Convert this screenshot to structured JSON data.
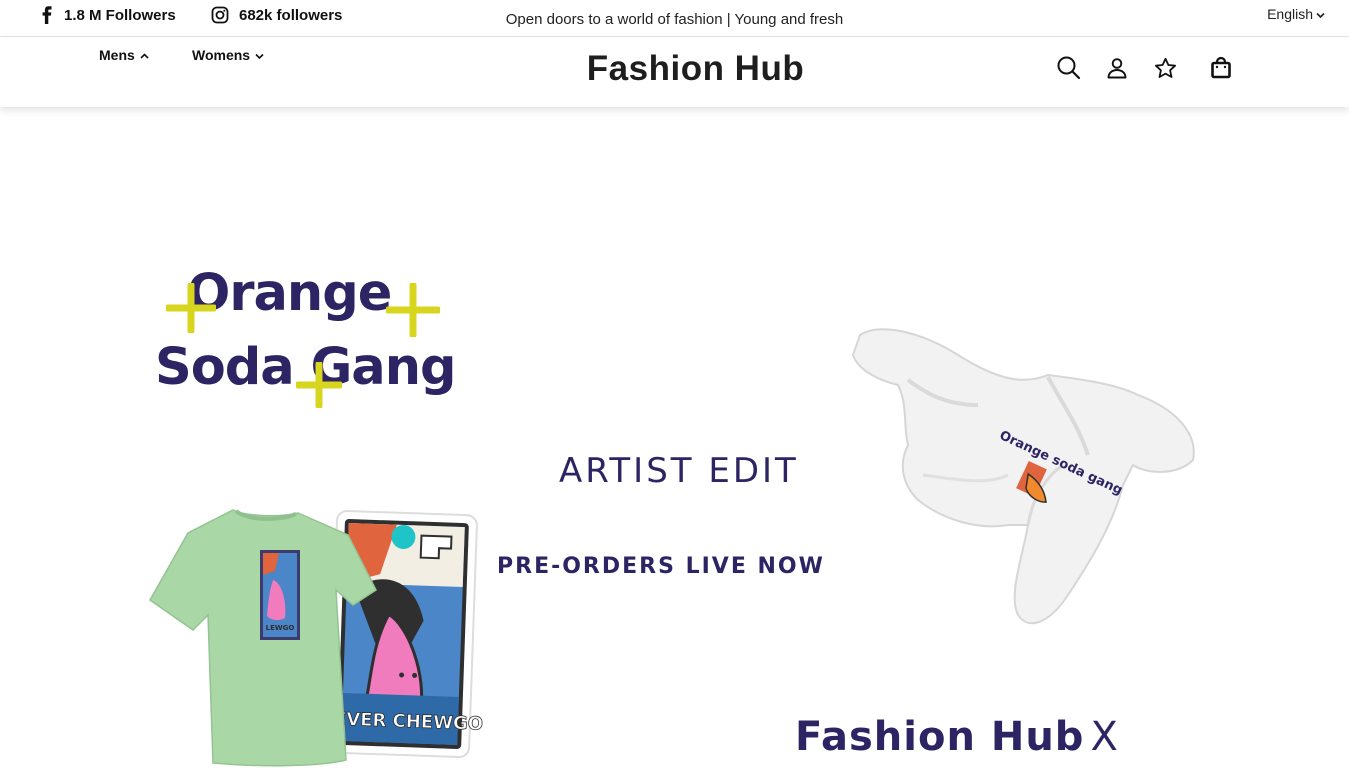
{
  "topbar": {
    "facebook": {
      "icon": "facebook-icon",
      "label": "1.8 M Followers"
    },
    "instagram": {
      "icon": "instagram-icon",
      "label": "682k followers"
    },
    "announcement": "Open doors to a world of fashion | Young and fresh",
    "language": "English"
  },
  "header": {
    "nav": [
      {
        "label": "Mens",
        "icon": "chevron-up-icon"
      },
      {
        "label": "Womens",
        "icon": "chevron-down-icon"
      }
    ],
    "brand": "Fashion Hub",
    "icons": [
      "search-icon",
      "user-icon",
      "star-icon",
      "shopping-bag-icon"
    ]
  },
  "hero": {
    "artwork_line1": "Orange",
    "artwork_line2": "Soda Gang",
    "artist_edit": "ARTIST EDIT",
    "preorders": "PRE-ORDERS LIVE NOW",
    "collab_brand": "Fashion Hub",
    "collab_x": "X",
    "tee_print_text": "NEVER CHEWGO",
    "jacket_print_text": "Orange soda gang"
  },
  "colors": {
    "brand_purple": "#2c2463",
    "plus_yellow": "#d8d51f",
    "tee_green": "#a9d8a6",
    "jacket_white": "#f2f2f2"
  }
}
